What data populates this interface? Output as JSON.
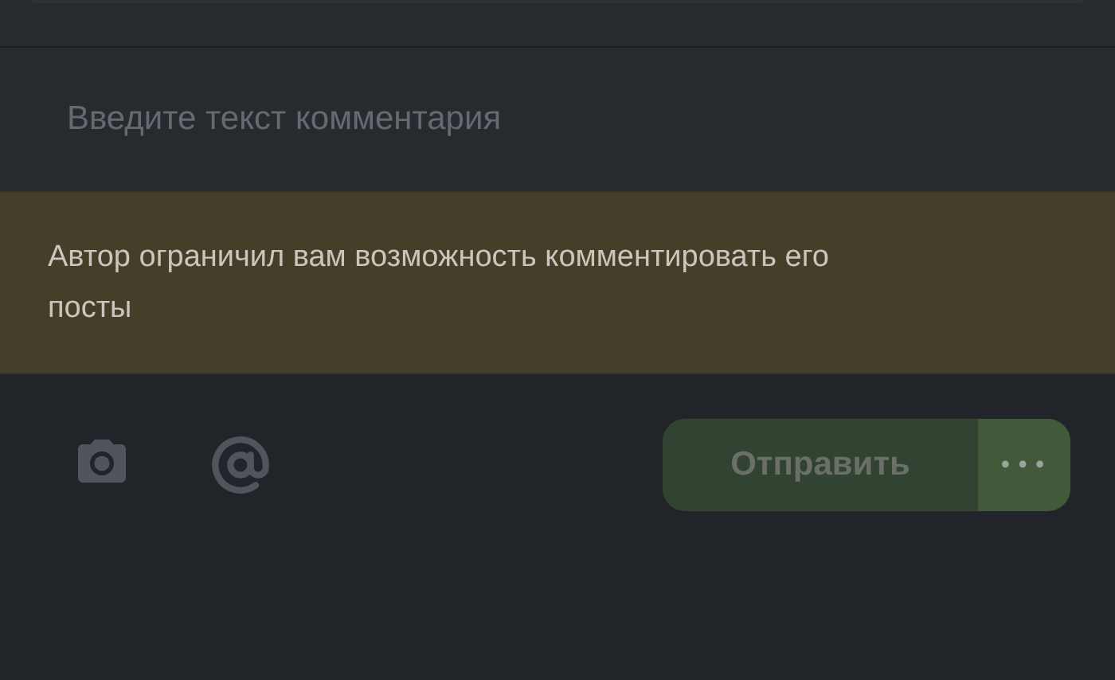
{
  "comment_field": {
    "placeholder": "Введите текст комментария"
  },
  "notice": {
    "text": "Автор ограничил вам возможность комментировать его посты"
  },
  "send_button": {
    "label": "Отправить",
    "disabled": true
  },
  "more_button": {
    "label": "•••"
  }
}
